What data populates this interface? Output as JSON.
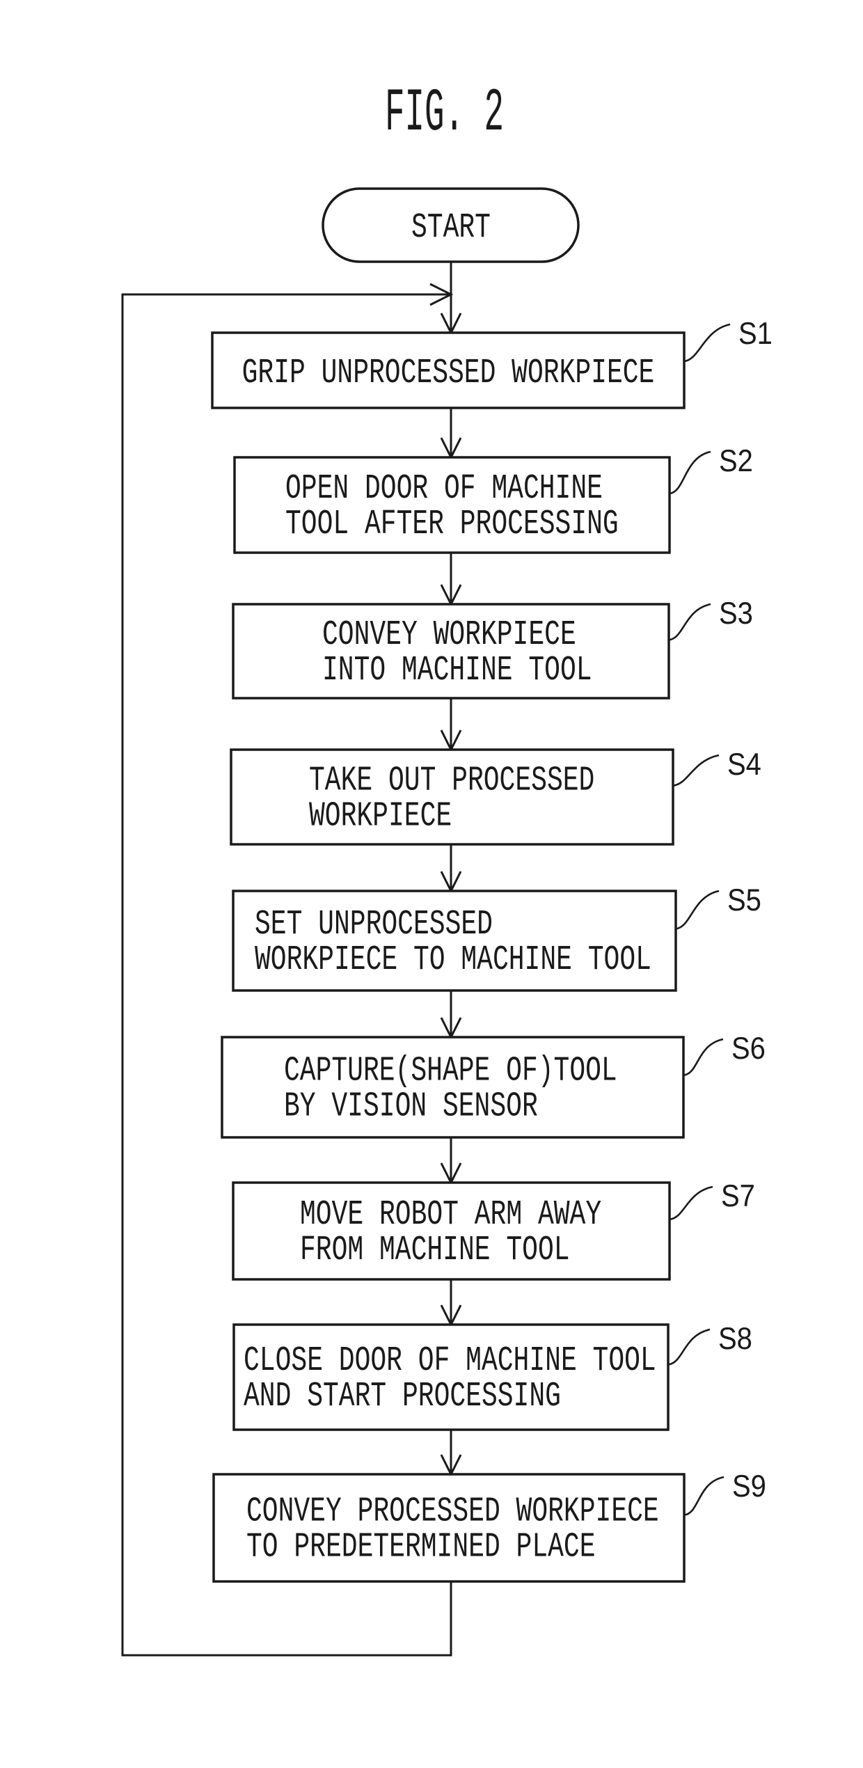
{
  "figure": {
    "title": "FIG. 2",
    "start_label": "START",
    "loop": "return from S9 to before S1",
    "steps": [
      {
        "id": "S1",
        "lines": [
          "GRIP UNPROCESSED WORKPIECE"
        ]
      },
      {
        "id": "S2",
        "lines": [
          "OPEN DOOR OF MACHINE",
          "TOOL AFTER PROCESSING"
        ]
      },
      {
        "id": "S3",
        "lines": [
          "CONVEY WORKPIECE",
          "INTO MACHINE TOOL"
        ]
      },
      {
        "id": "S4",
        "lines": [
          "TAKE OUT PROCESSED",
          "WORKPIECE"
        ]
      },
      {
        "id": "S5",
        "lines": [
          "SET UNPROCESSED",
          "WORKPIECE TO MACHINE TOOL"
        ]
      },
      {
        "id": "S6",
        "lines": [
          "CAPTURE(SHAPE OF)TOOL",
          "BY VISION SENSOR"
        ]
      },
      {
        "id": "S7",
        "lines": [
          "MOVE ROBOT ARM AWAY",
          "FROM MACHINE TOOL"
        ]
      },
      {
        "id": "S8",
        "lines": [
          "CLOSE DOOR OF MACHINE TOOL",
          "AND START PROCESSING"
        ]
      },
      {
        "id": "S9",
        "lines": [
          "CONVEY PROCESSED WORKPIECE",
          "TO PREDETERMINED PLACE"
        ]
      }
    ]
  }
}
